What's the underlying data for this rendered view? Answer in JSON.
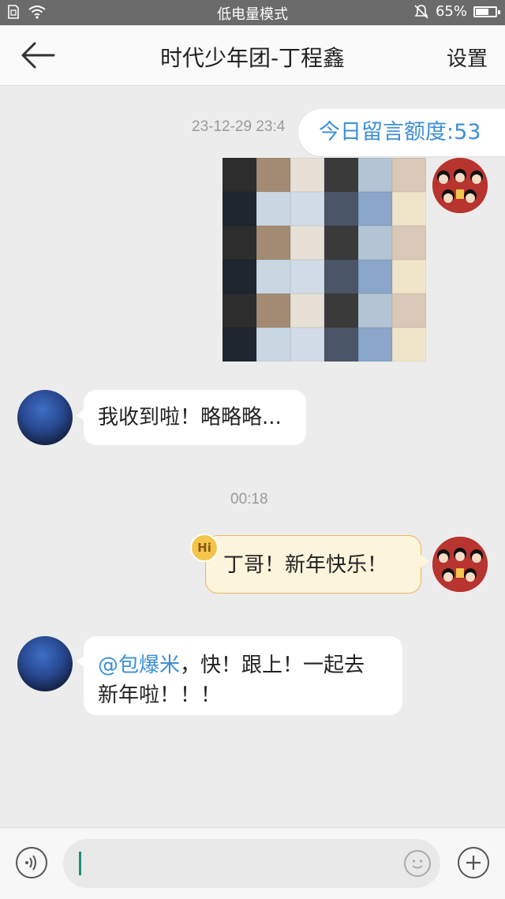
{
  "status_bar": {
    "mode_text": "低电量模式",
    "battery_percent": "65%",
    "battery_level": 0.65,
    "icons": [
      "sim-icon",
      "wifi-icon",
      "mute-icon",
      "battery-icon"
    ]
  },
  "header": {
    "back_icon": "arrow-left-icon",
    "title": "时代少年团-丁程鑫",
    "settings_label": "设置"
  },
  "quota_badge": "今日留言额度:53",
  "messages": [
    {
      "type": "timestamp",
      "text": "23-12-29 23:4"
    },
    {
      "type": "image",
      "side": "right",
      "alt": "sticker-collage"
    },
    {
      "type": "text",
      "side": "left",
      "text": "我收到啦！略略略..."
    },
    {
      "type": "timestamp",
      "text": "00:18"
    },
    {
      "type": "text",
      "side": "right",
      "badge": "Hi",
      "text": "丁哥！新年快乐！"
    },
    {
      "type": "text",
      "side": "left",
      "mention": "@包爆米",
      "text_line1": "，快！跟上！一起去",
      "text_line2": "新年啦！！！"
    }
  ],
  "input_bar": {
    "voice_icon": "voice-icon",
    "emoji_icon": "smiley-icon",
    "plus_icon": "plus-icon",
    "value": ""
  },
  "colors": {
    "accent": "#3d8fd6",
    "background": "#ececec",
    "self_bubble": "#fdf4dc",
    "self_bubble_border": "#e6b860",
    "status_bar": "#6b6b6b"
  }
}
